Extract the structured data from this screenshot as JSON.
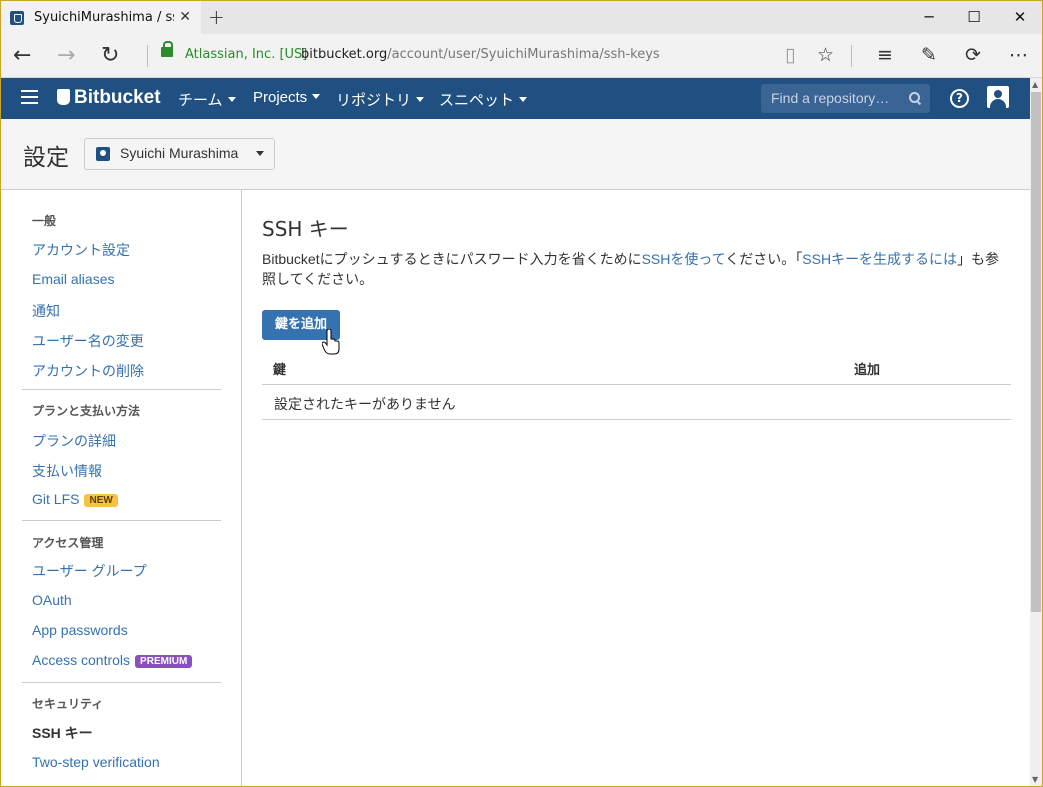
{
  "browser": {
    "tab_title": "SyuichiMurashima / ssh",
    "cert_label": "Atlassian, Inc. [US]",
    "url_host": "bitbucket.org",
    "url_path": "/account/user/SyuichiMurashima/ssh-keys"
  },
  "header": {
    "logo": "Bitbucket",
    "nav": [
      "チーム",
      "Projects",
      "リポジトリ",
      "スニペット"
    ],
    "search_placeholder": "Find a repository…",
    "help": "?"
  },
  "subheader": {
    "title": "設定",
    "account": "Syuichi Murashima"
  },
  "sidebar": {
    "general_title": "一般",
    "general": [
      "アカウント設定",
      "Email aliases",
      "通知",
      "ユーザー名の変更",
      "アカウントの削除"
    ],
    "plan_title": "プランと支払い方法",
    "plan": [
      "プランの詳細",
      "支払い情報",
      "Git LFS"
    ],
    "plan_badge": "NEW",
    "access_title": "アクセス管理",
    "access": [
      "ユーザー グループ",
      "OAuth",
      "App passwords",
      "Access controls"
    ],
    "access_badge": "PREMIUM",
    "security_title": "セキュリティ",
    "security": [
      "SSH キー",
      "Two-step verification"
    ]
  },
  "main": {
    "title": "SSH キー",
    "desc_1": "Bitbucketにプッシュするときにパスワード入力を省くために",
    "desc_link1": "SSHを使って",
    "desc_2": "ください。「",
    "desc_link2": "SSHキーを生成するには",
    "desc_3": "」も参照してください。",
    "add_button": "鍵を追加",
    "col_key": "鍵",
    "col_added": "追加",
    "empty_text": "設定されたキーがありません"
  }
}
